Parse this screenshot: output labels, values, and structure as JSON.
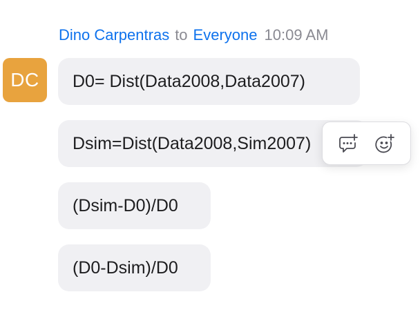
{
  "message": {
    "sender": "Dino Carpentras",
    "to_label": "to",
    "recipient": "Everyone",
    "time": "10:09 AM",
    "avatar_initials": "DC",
    "avatar_color": "#e8a33e"
  },
  "bubbles": [
    {
      "text": "D0= Dist(Data2008,Data2007)"
    },
    {
      "text": "Dsim=Dist(Data2008,Sim2007)"
    },
    {
      "text": "(Dsim-D0)/D0"
    },
    {
      "text": "(D0-Dsim)/D0"
    }
  ],
  "hover_actions": {
    "reply_icon": "reply-in-thread-icon",
    "reaction_icon": "add-reaction-icon"
  },
  "colors": {
    "link": "#0e72ed",
    "muted": "#8a8a92",
    "bubble_bg": "#f0f0f3"
  }
}
